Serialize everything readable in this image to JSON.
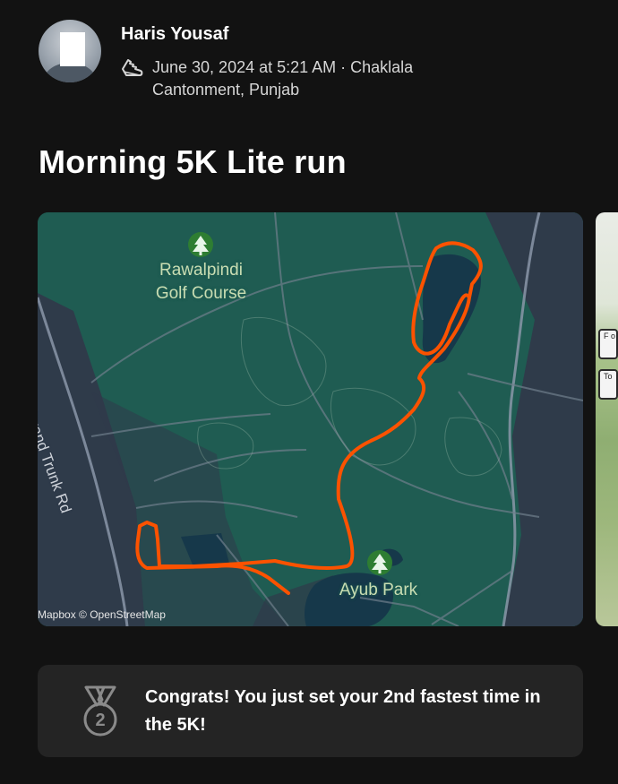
{
  "athlete": {
    "name": "Haris Yousaf",
    "datetime_line": "June 30, 2024 at 5:21 AM · Chaklala",
    "location_line": "Cantonment, Punjab"
  },
  "activity": {
    "title": "Morning 5K Lite run"
  },
  "map": {
    "poi_golf_line1": "Rawalpindi",
    "poi_golf_line2": "Golf Course",
    "poi_park": "Ayub Park",
    "road_name": "Grand Trunk Rd",
    "attribution": "Mapbox © OpenStreetMap",
    "colors": {
      "land": "#1f5c52",
      "urban": "#2f3b4a",
      "water": "#16384a",
      "route": "#fc5200"
    }
  },
  "side_photo": {
    "tag1": "F o",
    "tag2": "To"
  },
  "achievement": {
    "medal_rank": "2",
    "message": "Congrats! You just set your 2nd fastest time in the 5K!"
  },
  "icons": {
    "activity_type": "running-shoe-icon",
    "medal": "medal-icon",
    "tree": "tree-icon"
  }
}
